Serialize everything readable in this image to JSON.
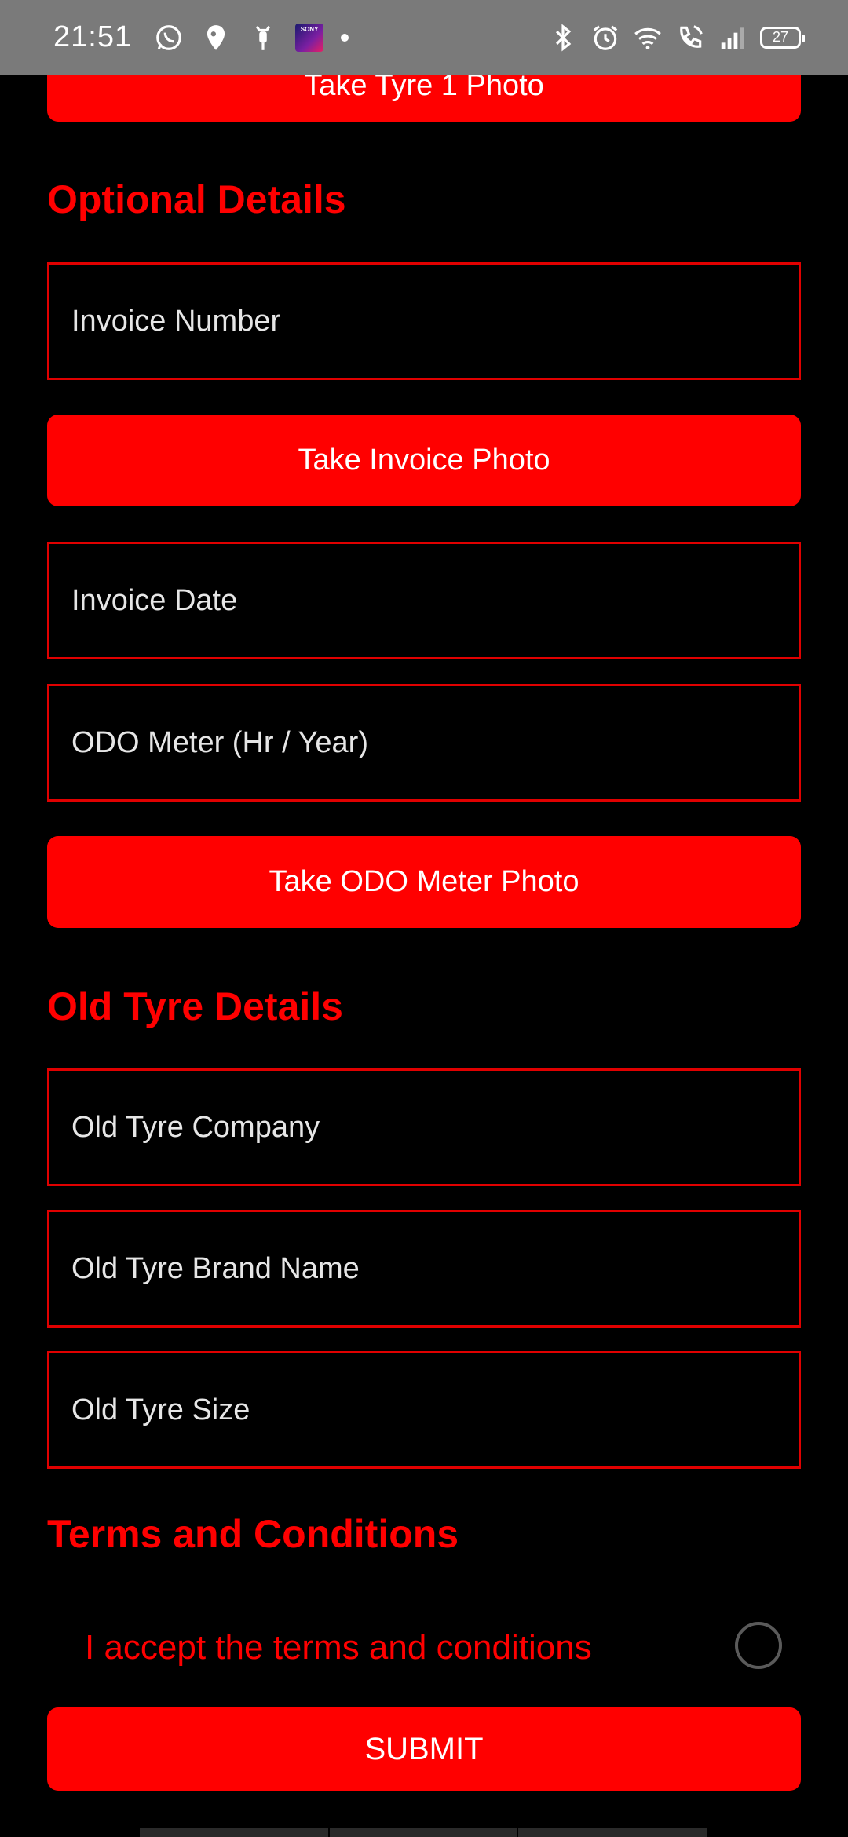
{
  "status_bar": {
    "time": "21:51",
    "battery_level": "27",
    "left_icons": [
      "whatsapp-icon",
      "location-icon",
      "scooter-icon",
      "sony-liv-icon",
      "dot-icon"
    ],
    "right_icons": [
      "bluetooth-icon",
      "alarm-icon",
      "wifi-icon",
      "call-icon",
      "signal-icon",
      "battery-icon"
    ],
    "sony_tile_text": "SONY"
  },
  "form": {
    "tyre_photo_button": "Take Tyre 1 Photo",
    "optional_title": "Optional Details",
    "invoice_number_placeholder": "Invoice Number",
    "invoice_photo_button": "Take Invoice Photo",
    "invoice_date_placeholder": "Invoice Date",
    "odo_meter_placeholder": "ODO Meter (Hr / Year)",
    "odo_photo_button": "Take ODO Meter Photo",
    "old_tyre_title": "Old Tyre Details",
    "old_tyre_company_placeholder": "Old Tyre Company",
    "old_tyre_brand_placeholder": "Old Tyre Brand Name",
    "old_tyre_size_placeholder": "Old Tyre Size",
    "terms_title": "Terms and Conditions",
    "terms_label": "I accept the terms and conditions",
    "terms_accepted": false,
    "submit_button": "SUBMIT"
  },
  "colors": {
    "accent": "#ff0000",
    "background": "#000000",
    "status_bar": "#7a7a7a"
  }
}
